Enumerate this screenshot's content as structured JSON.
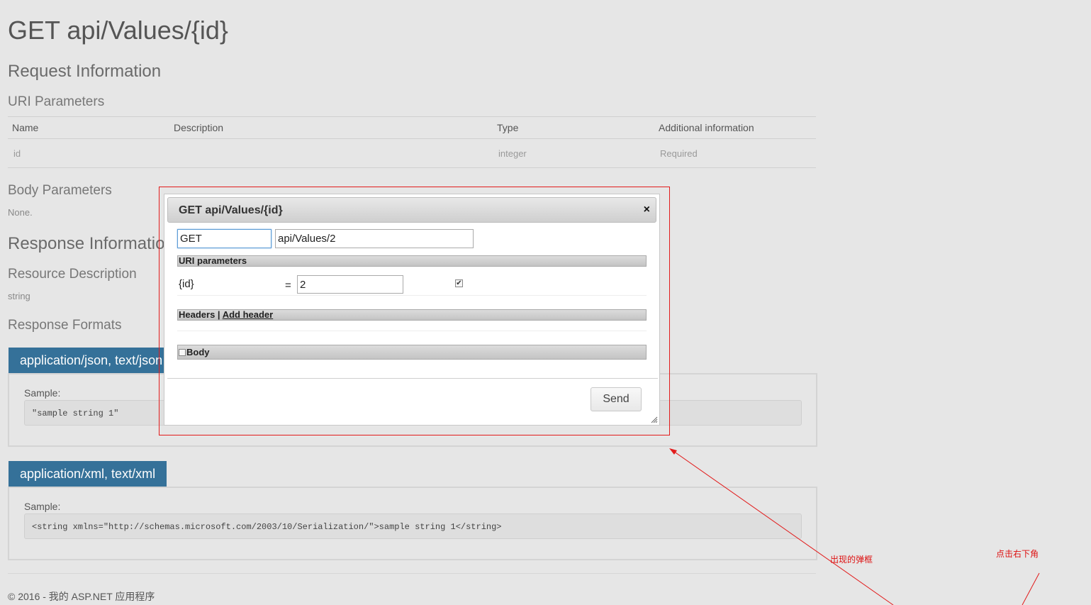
{
  "page": {
    "title": "GET api/Values/{id}",
    "request_information": "Request Information",
    "uri_parameters_heading": "URI Parameters",
    "body_parameters_heading": "Body Parameters",
    "body_parameters_value": "None.",
    "response_information": "Response Information",
    "resource_description_heading": "Resource Description",
    "resource_description_value": "string",
    "response_formats_heading": "Response Formats"
  },
  "uri_table": {
    "headers": [
      "Name",
      "Description",
      "Type",
      "Additional information"
    ],
    "rows": [
      {
        "name": "id",
        "description": "",
        "type": "integer",
        "additional": "Required"
      }
    ]
  },
  "formats": [
    {
      "tab": "application/json, text/json",
      "sample_label": "Sample:",
      "sample": "\"sample string 1\""
    },
    {
      "tab": "application/xml, text/xml",
      "sample_label": "Sample:",
      "sample": "<string xmlns=\"http://schemas.microsoft.com/2003/10/Serialization/\">sample string 1</string>"
    }
  ],
  "footer": "© 2016 - 我的 ASP.NET 应用程序",
  "dialog": {
    "title": "GET api/Values/{id}",
    "close_icon": "×",
    "method_value": "GET",
    "url_value": "api/Values/2",
    "uri_parameters_label": "URI parameters",
    "param_name": "{id}",
    "param_eq": "=",
    "param_value": "2",
    "param_checked": true,
    "headers_label": "Headers | ",
    "add_header_label": "Add header",
    "body_label": "Body",
    "send_label": "Send"
  },
  "annotations": {
    "popup_note": "出现的弹框",
    "click_note": "点击右下角",
    "color": "#e21b1b"
  }
}
